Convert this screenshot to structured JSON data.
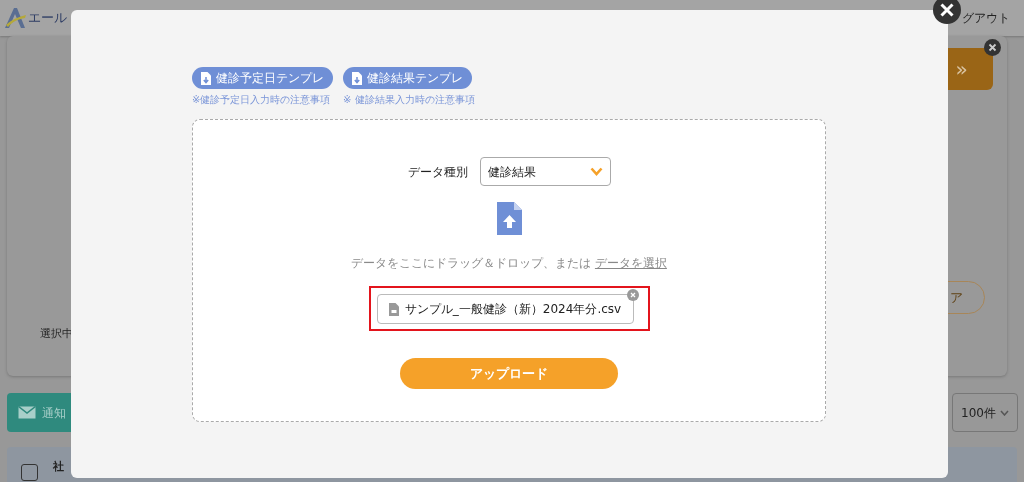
{
  "header": {
    "logo_text": "エール",
    "logout": "グアウト"
  },
  "background": {
    "next_button": "»",
    "clear_button": "ア",
    "selection_label": "選択中",
    "notify_button": "通知",
    "page_size": "100件",
    "row_header": "社",
    "row_checked": false
  },
  "modal": {
    "templates": [
      {
        "label": "健診予定日テンプレ",
        "note": "※健診予定日入力時の注意事項"
      },
      {
        "label": "健診結果テンプレ",
        "note": "※ 健診結果入力時の注意事項"
      }
    ],
    "data_type": {
      "label": "データ種別",
      "value": "健診結果"
    },
    "drop_text": "データをここにドラッグ＆ドロップ、または",
    "select_link": "データを選択",
    "files": [
      {
        "name": "サンプル_一般健診（新）2024年分.csv",
        "highlighted": true
      }
    ],
    "upload_button": "アップロード"
  }
}
